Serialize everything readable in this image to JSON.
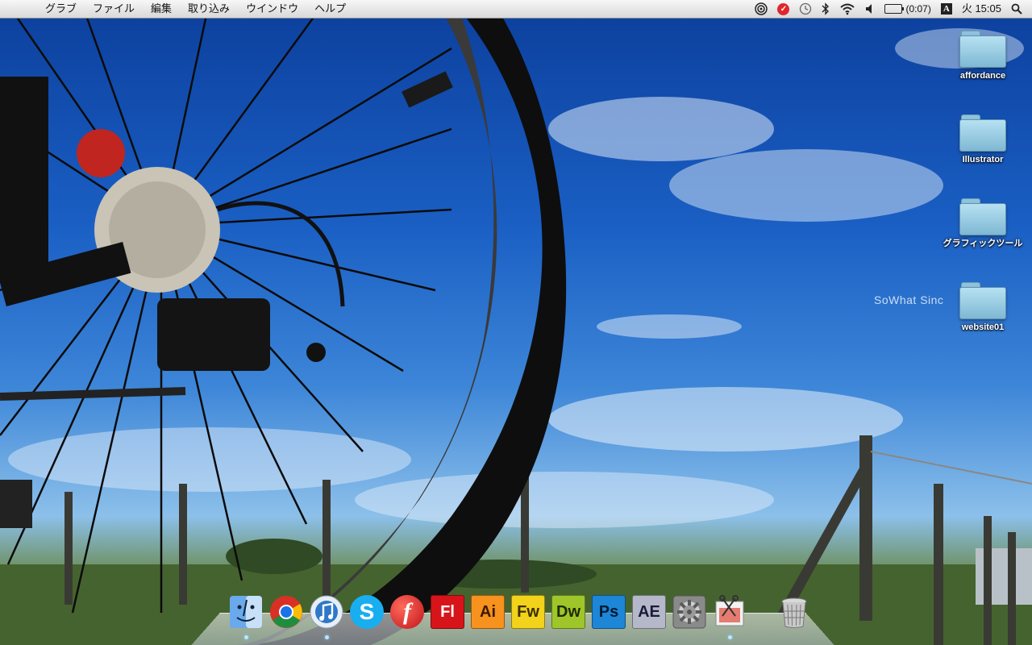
{
  "menubar": {
    "apple_icon": "apple-icon",
    "menus": [
      "グラブ",
      "ファイル",
      "編集",
      "取り込み",
      "ウインドウ",
      "ヘルプ"
    ],
    "status": {
      "battery_time": "(0:07)",
      "input_method": "A",
      "clock": "火 15:05",
      "adobe_badge": "✓"
    }
  },
  "desktop": {
    "icons": [
      {
        "label": "affordance"
      },
      {
        "label": "Illustrator"
      },
      {
        "label": "グラフィックツール"
      },
      {
        "label": "website01"
      }
    ],
    "watermark": "SoWhat Sinc"
  },
  "dock": {
    "items": [
      {
        "name": "Finder",
        "icon": "finder-icon"
      },
      {
        "name": "Google Chrome",
        "icon": "chrome-icon"
      },
      {
        "name": "iTunes",
        "icon": "itunes-icon"
      },
      {
        "name": "Skype",
        "icon": "skype-icon",
        "text": "S"
      },
      {
        "name": "Flash Player",
        "icon": "flash-player-icon",
        "text": "f"
      },
      {
        "name": "Flash",
        "icon": "flash-icon",
        "text": "Fl"
      },
      {
        "name": "Illustrator",
        "icon": "illustrator-icon",
        "text": "Ai"
      },
      {
        "name": "Fireworks",
        "icon": "fireworks-icon",
        "text": "Fw"
      },
      {
        "name": "Dreamweaver",
        "icon": "dreamweaver-icon",
        "text": "Dw"
      },
      {
        "name": "Photoshop",
        "icon": "photoshop-icon",
        "text": "Ps"
      },
      {
        "name": "After Effects",
        "icon": "after-effects-icon",
        "text": "AE"
      },
      {
        "name": "System Preferences",
        "icon": "system-preferences-icon"
      },
      {
        "name": "Screen Capture",
        "icon": "scissors-icon"
      },
      {
        "name": "Trash",
        "icon": "trash-icon"
      }
    ]
  },
  "colors": {
    "flash": "#d8141b",
    "illustrator": "#f7921e",
    "fireworks": "#f2d21a",
    "dreamweaver": "#9ec62a",
    "photoshop": "#1d86d6",
    "after_effects": "#b5b8c8",
    "skype": "#19aef0"
  }
}
